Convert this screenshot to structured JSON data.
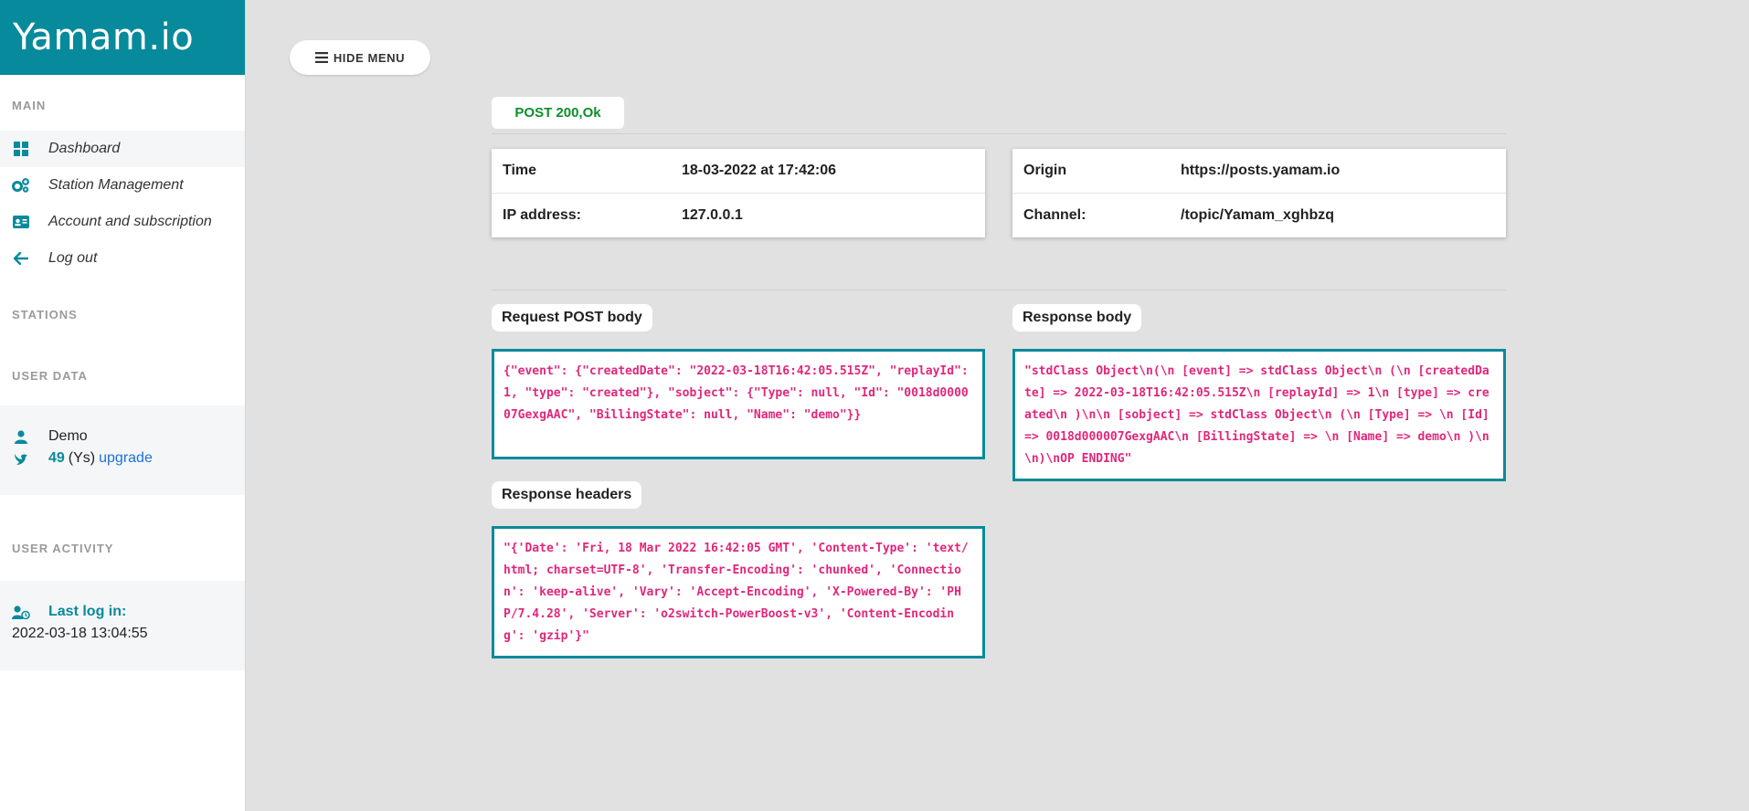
{
  "brand": "Yamam.io",
  "sidebar": {
    "sections": {
      "main": "MAIN",
      "stations": "STATIONS",
      "user_data": "USER DATA",
      "user_activity": "USER ACTIVITY"
    },
    "nav": [
      {
        "label": "Dashboard",
        "icon": "dashboard-icon"
      },
      {
        "label": "Station Management",
        "icon": "gears-icon"
      },
      {
        "label": "Account and subscription",
        "icon": "id-card-icon"
      },
      {
        "label": "Log out",
        "icon": "arrow-left-icon"
      }
    ],
    "user": {
      "name": "Demo",
      "credits": "49",
      "credits_unit": "(Ys)",
      "upgrade": "upgrade"
    },
    "activity": {
      "last_login_label": "Last log in:",
      "last_login_value": "2022-03-18 13:04:55"
    }
  },
  "toolbar": {
    "hide_menu": "HIDE MENU"
  },
  "status": "POST 200,Ok",
  "info_left": {
    "rows": [
      {
        "key": "Time",
        "value": "18-03-2022 at 17:42:06"
      },
      {
        "key": "IP address:",
        "value": "127.0.0.1"
      }
    ]
  },
  "info_right": {
    "rows": [
      {
        "key": "Origin",
        "value": "https://posts.yamam.io"
      },
      {
        "key": "Channel:",
        "value": "/topic/Yamam_xghbzq"
      }
    ]
  },
  "request_body": {
    "label": "Request POST body",
    "content": "{\"event\": {\"createdDate\": \"2022-03-18T16:42:05.515Z\", \"replayId\": 1, \"type\": \"created\"}, \"sobject\": {\"Type\": null, \"Id\": \"0018d000007GexgAAC\", \"BillingState\": null, \"Name\": \"demo\"}}"
  },
  "response_headers": {
    "label": "Response headers",
    "content": "\"{'Date': 'Fri, 18 Mar 2022 16:42:05 GMT', 'Content-Type': 'text/html; charset=UTF-8', 'Transfer-Encoding': 'chunked', 'Connection': 'keep-alive', 'Vary': 'Accept-Encoding', 'X-Powered-By': 'PHP/7.4.28', 'Server': 'o2switch-PowerBoost-v3', 'Content-Encoding': 'gzip'}\""
  },
  "response_body": {
    "label": "Response body",
    "content": "\"stdClass Object\\n(\\n [event] => stdClass Object\\n (\\n [createdDate] => 2022-03-18T16:42:05.515Z\\n [replayId] => 1\\n [type] => created\\n )\\n\\n [sobject] => stdClass Object\\n (\\n [Type] => \\n [Id] => 0018d000007GexgAAC\\n [BillingState] => \\n [Name] => demo\\n )\\n\\n)\\nOP ENDING\""
  },
  "colors": {
    "accent": "#078a9b",
    "status_ok": "#0a8f2a",
    "code": "#e0277b",
    "link": "#1a73d9"
  }
}
